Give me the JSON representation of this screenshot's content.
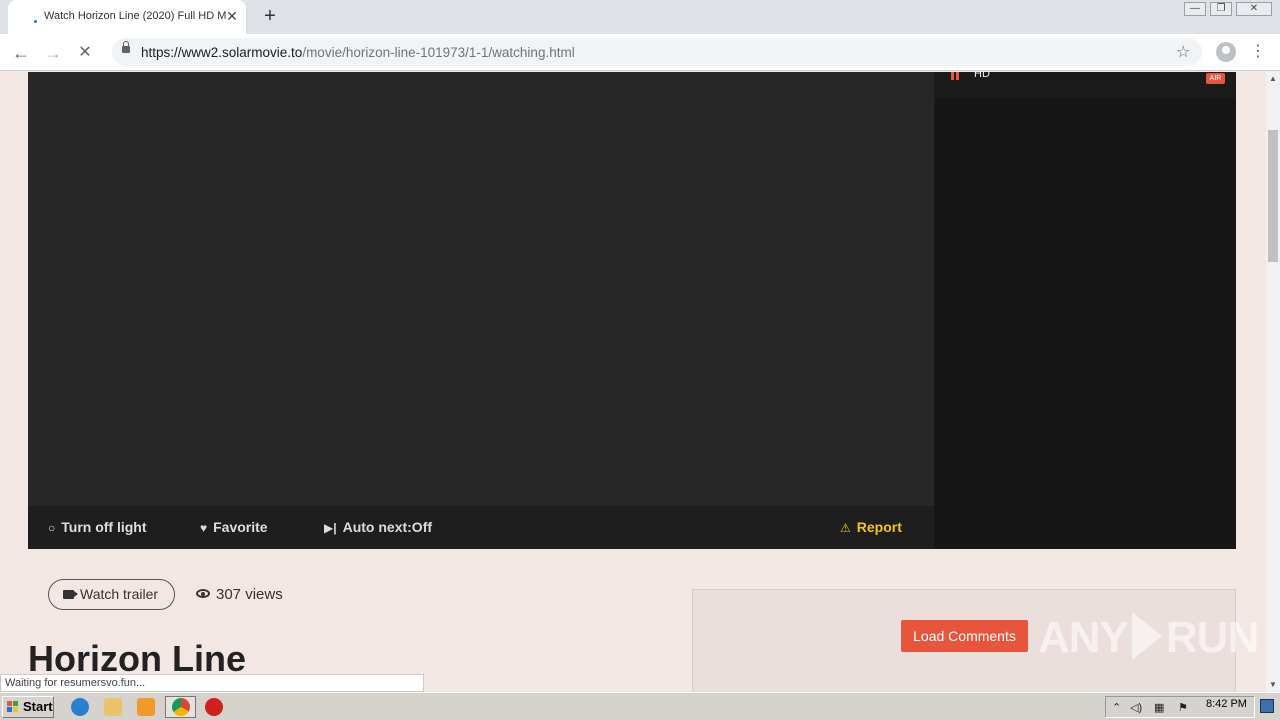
{
  "browser": {
    "tab_title": "Watch Horizon Line (2020) Full HD M",
    "tab_close": "✕",
    "new_tab": "+",
    "window_controls": {
      "minimize": "—",
      "restore": "❐",
      "close": "✕"
    },
    "nav": {
      "back": "←",
      "forward": "→",
      "reload": "✕"
    },
    "url_host": "https://www2.solarmovie.to",
    "url_path": "/movie/horizon-line-101973/1-1/watching.html",
    "star": "☆",
    "menu": "⋮"
  },
  "player": {
    "controls": {
      "light": "Turn off light",
      "favorite": "Favorite",
      "autonext": "Auto next:Off",
      "report": "Report"
    },
    "icons": {
      "light": "💡",
      "favorite": "♥",
      "autonext": "⏭",
      "report": "⚠"
    }
  },
  "servers": {
    "items": [
      {
        "label": "HD",
        "badge": "AIR"
      }
    ]
  },
  "movie": {
    "trailer_label": "Watch trailer",
    "views": "307 views",
    "title": "Horizon Line"
  },
  "comments": {
    "load_label": "Load Comments",
    "watermark": {
      "left": "ANY",
      "right": "RUN"
    }
  },
  "status": {
    "text": "Waiting for resumersvo.fun..."
  },
  "taskbar": {
    "start_label": "Start",
    "clock": "8:42 PM"
  },
  "scrollbar": {
    "up": "▲",
    "down": "▼"
  },
  "colors": {
    "accent": "#e8553d",
    "report": "#f5c518",
    "player_bg": "#272727"
  }
}
